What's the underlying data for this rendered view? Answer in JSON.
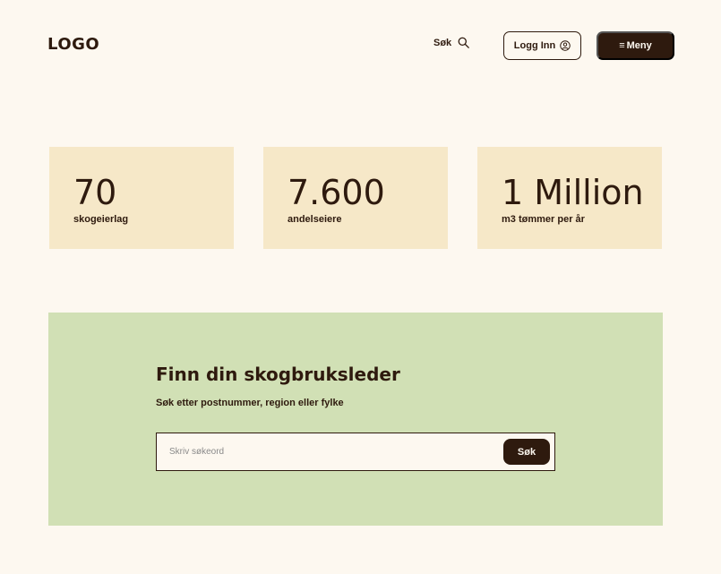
{
  "header": {
    "logo": "LOGO",
    "search_label": "Søk",
    "search_icon": "search-icon",
    "login_label": "Logg Inn",
    "login_icon": "user-circle-icon",
    "menu_icon_glyph": "≡",
    "menu_label": "Meny"
  },
  "stats": [
    {
      "value": "70",
      "label": "skogeierlag"
    },
    {
      "value": "7.600",
      "label": "andelseiere"
    },
    {
      "value": "1 Million",
      "label": "m3 tømmer per år"
    }
  ],
  "finder": {
    "title": "Finn din skogbruksleder",
    "subtitle": "Søk etter postnummer, region eller fylke",
    "input_placeholder": "Skriv søkeord",
    "input_value": "",
    "submit_label": "Søk"
  },
  "colors": {
    "background": "#fdf8f0",
    "primary_dark": "#2e1a0e",
    "stat_card": "#f6e8c8",
    "finder_bg": "#d1e0b5"
  }
}
